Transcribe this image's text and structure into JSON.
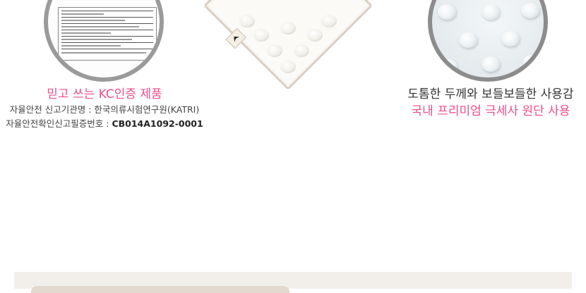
{
  "left_section": {
    "title": "믿고 쓰는 KC인증 제품",
    "agency_line": "자율안전 신고기관명 : 한국의류시험연구원(KATRI)",
    "cert_label": "자율안전확인신고필증번호 : ",
    "cert_number": "CB014A1092-0001"
  },
  "right_section": {
    "line1": "도톰한 두께와 보들보들한 사용감",
    "line2": "국내 프리미엄 극세사 원단 사용"
  },
  "colors": {
    "accent_pink": "#ee4d8b",
    "text_gray": "#444444",
    "band": "#f2efeb"
  },
  "icons": {
    "certificate": "kc-certificate-document",
    "product": "minky-dot-blanket",
    "fabric": "minky-dot-texture"
  }
}
